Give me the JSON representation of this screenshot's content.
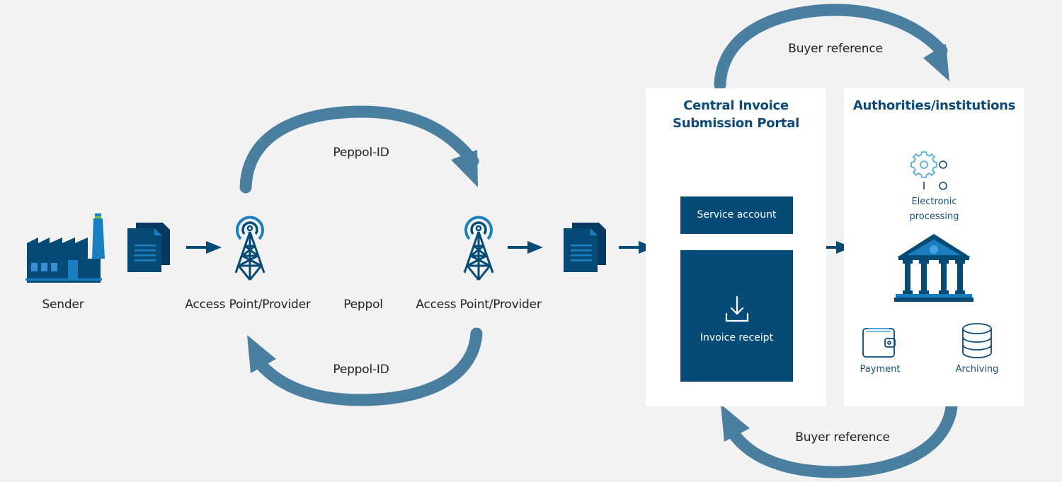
{
  "diagram": {
    "colors": {
      "background": "#f2f2f2",
      "panel": "#ffffff",
      "dark_blue": "#054b76",
      "arrow_curve": "#4a7fa0",
      "accent_blue": "#1a7fc1",
      "title_blue": "#0d4a78"
    },
    "nodes": {
      "sender": {
        "label": "Sender",
        "icon": "factory-icon"
      },
      "document_1": {
        "icon": "document-icon"
      },
      "access_point_1": {
        "label": "Access Point/Provider",
        "icon": "antenna-tower-icon"
      },
      "network": {
        "label": "Peppol"
      },
      "access_point_2": {
        "label": "Access Point/Provider",
        "icon": "antenna-tower-icon"
      },
      "document_2": {
        "icon": "document-icon"
      }
    },
    "curved_arrows": {
      "peppol_top": {
        "label": "Peppol-ID",
        "direction": "left-to-right"
      },
      "peppol_bottom": {
        "label": "Peppol-ID",
        "direction": "right-to-left"
      },
      "buyer_top": {
        "label": "Buyer reference",
        "direction": "left-to-right"
      },
      "buyer_bottom": {
        "label": "Buyer reference",
        "direction": "right-to-left"
      }
    },
    "portal": {
      "title_line1": "Central Invoice",
      "title_line2": "Submission Portal",
      "service_account": "Service account",
      "invoice_receipt": "Invoice receipt",
      "invoice_receipt_icon": "download-icon"
    },
    "authorities": {
      "title": "Authorities/institutions",
      "electronic_processing_line1": "Electronic",
      "electronic_processing_line2": "processing",
      "processing_icon": "gear-icon",
      "building_icon": "government-building-icon",
      "payment": "Payment",
      "payment_icon": "wallet-icon",
      "archiving": "Archiving",
      "archiving_icon": "database-icon"
    }
  }
}
